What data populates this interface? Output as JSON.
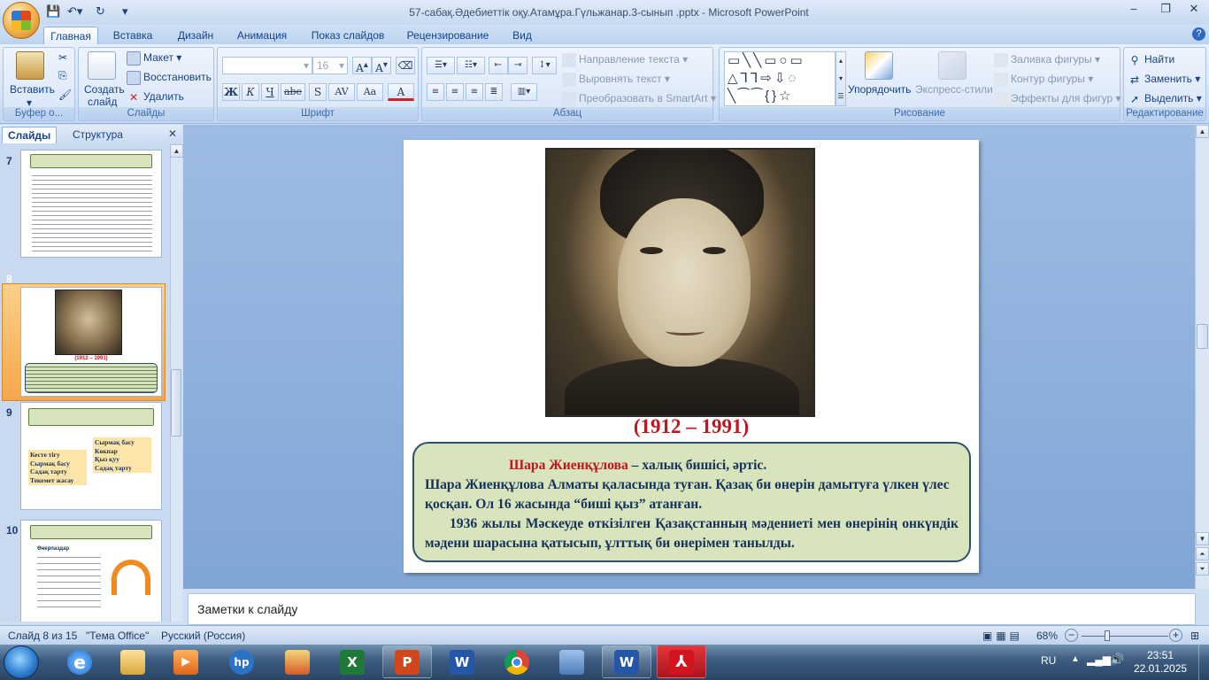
{
  "window": {
    "title": "57-сабақ.Әдебиеттік оқу.Атамұра.Гүльжанар.3-сынып   .pptx - Microsoft PowerPoint"
  },
  "ribbon_tabs": [
    "Главная",
    "Вставка",
    "Дизайн",
    "Анимация",
    "Показ слайдов",
    "Рецензирование",
    "Вид"
  ],
  "clipboard": {
    "paste": "Вставить",
    "group": "Буфер о..."
  },
  "slides_group": {
    "create": "Создать",
    "create2": "слайд",
    "layout": "Макет",
    "reset": "Восстановить",
    "delete": "Удалить",
    "group": "Слайды"
  },
  "font_group": {
    "font_size": "16",
    "group": "Шрифт",
    "bold": "Ж",
    "italic": "К",
    "underline": "Ч",
    "strike": "abe",
    "shadow": "S",
    "spacing": "AV",
    "case": "Aa",
    "color": "A"
  },
  "paragraph_group": {
    "text_direction": "Направление текста",
    "align_text": "Выровнять текст",
    "smartart": "Преобразовать в SmartArt",
    "group": "Абзац"
  },
  "drawing_group": {
    "arrange": "Упорядочить",
    "quick_styles": "Экспресс-стили",
    "fill": "Заливка фигуры",
    "outline": "Контур фигуры",
    "effects": "Эффекты для фигур",
    "group": "Рисование"
  },
  "editing_group": {
    "find": "Найти",
    "replace": "Заменить",
    "select": "Выделить",
    "group": "Редактирование"
  },
  "left_pane": {
    "tab_slides": "Слайды",
    "tab_outline": "Структура",
    "thumbs": [
      {
        "num": "7"
      },
      {
        "num": "8",
        "years": "(1912 – 1991)"
      },
      {
        "num": "9",
        "col1": [
          "Кесте тігу",
          "Сырмақ басу",
          "Садақ тарту",
          "Текемет жасау"
        ],
        "col2": [
          "Сырмақ басу",
          "Көкпар",
          "Қыз қуу",
          "Садақ тарту"
        ]
      },
      {
        "num": "10",
        "heading": "Өнерпаздар"
      }
    ]
  },
  "slide": {
    "years": "(1912 – 1991)",
    "name": "Шара Жиенқұлова",
    "line1": " – халық бишісі, әртіс.",
    "line2": "Шара Жиенқұлова Алматы қаласында туған. Қазақ би өнерін дамытуға үлкен үлес қосқан. Ол 16 жасында “биші қыз” атанған.",
    "line3": "1936 жылы Мәскеуде өткізілген Қазақстанның мәдениеті мен өнерінің онкүндік мәдени шарасына қатысып, ұлттық би өнерімен танылды."
  },
  "notes": {
    "placeholder": "Заметки к слайду"
  },
  "status": {
    "slide": "Слайд 8 из 15",
    "theme": "\"Тема Office\"",
    "language": "Русский (Россия)",
    "zoom": "68%"
  },
  "tray": {
    "lang": "RU",
    "time": "23:51",
    "date": "22.01.2025"
  }
}
